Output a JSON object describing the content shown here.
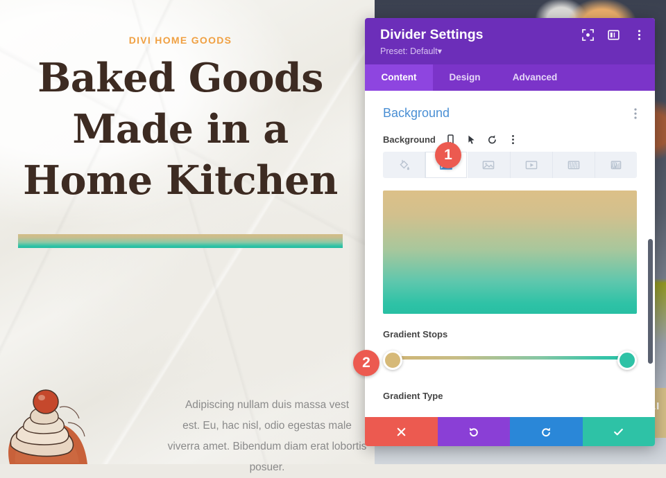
{
  "page": {
    "eyebrow": "DIVI HOME GOODS",
    "headline_lines": [
      "Baked Goods",
      "Made in a",
      "Home Kitchen"
    ],
    "headline": "Baked Goods Made in a Home Kitchen",
    "body_lines": [
      "Adipiscing nullam duis massa vest",
      "est. Eu, hac nisl, odio egestas male",
      "viverra amet. Bibendum diam erat lobortis posuer."
    ],
    "divider_gradient": {
      "from": "#d3bd86",
      "to": "#2ec2a6",
      "direction": "to bottom"
    },
    "accent_color": "#f0a042",
    "heading_color": "#3d2b22",
    "ribbon_text": "LI"
  },
  "modal": {
    "title": "Divider Settings",
    "preset": "Preset: Default",
    "preset_caret": "▾",
    "header_icons": [
      {
        "name": "focus-mode-icon",
        "label": "Focus Mode"
      },
      {
        "name": "panel-layout-icon",
        "label": "Panel Layout"
      },
      {
        "name": "more-options-icon",
        "label": "More Options"
      }
    ],
    "tabs": [
      {
        "label": "Content",
        "active": true
      },
      {
        "label": "Design",
        "active": false
      },
      {
        "label": "Advanced",
        "active": false
      }
    ],
    "header_color": "#6c2eb9",
    "tabbar_color": "#7b34c9",
    "active_tab_color": "#8e45e0"
  },
  "section": {
    "title": "Background",
    "title_color": "#4a8fd4",
    "options_icon": "kebab-menu-icon"
  },
  "background_field": {
    "label": "Background",
    "controls": [
      {
        "name": "responsive-mobile-icon",
        "label": "Responsive"
      },
      {
        "name": "hover-cursor-icon",
        "label": "Hover"
      },
      {
        "name": "reset-icon",
        "label": "Reset"
      },
      {
        "name": "field-options-icon",
        "label": "Options"
      }
    ],
    "type_tabs": [
      {
        "name": "background-color-tab",
        "icon": "paint-bucket-icon",
        "label": "Background Color",
        "active": false
      },
      {
        "name": "background-gradient-tab",
        "icon": "gradient-icon",
        "label": "Background Gradient",
        "active": true
      },
      {
        "name": "background-image-tab",
        "icon": "image-icon",
        "label": "Background Image",
        "active": false
      },
      {
        "name": "background-video-tab",
        "icon": "video-icon",
        "label": "Background Video",
        "active": false
      },
      {
        "name": "background-pattern-tab",
        "icon": "pattern-icon",
        "label": "Background Pattern",
        "active": false
      },
      {
        "name": "background-mask-tab",
        "icon": "mask-icon",
        "label": "Background Mask",
        "active": false
      }
    ]
  },
  "gradient": {
    "preview_from": "#dcc088",
    "preview_to": "#2ec2a6",
    "stops_label": "Gradient Stops",
    "type_label": "Gradient Type",
    "stops": [
      {
        "position": 0,
        "color": "#d6b978"
      },
      {
        "position": 100,
        "color": "#2ec2a6"
      }
    ]
  },
  "footer_buttons": [
    {
      "name": "cancel-button",
      "icon": "close-icon",
      "label": "Cancel",
      "color": "#ec5a50"
    },
    {
      "name": "undo-button",
      "icon": "undo-icon",
      "label": "Undo",
      "color": "#8a3fd6"
    },
    {
      "name": "redo-button",
      "icon": "redo-icon",
      "label": "Redo",
      "color": "#2a87d8"
    },
    {
      "name": "save-button",
      "icon": "check-icon",
      "label": "Save",
      "color": "#2ec2a6"
    }
  ],
  "annotations": [
    {
      "number": "1",
      "color": "#ec5a50"
    },
    {
      "number": "2",
      "color": "#ec5a50"
    }
  ]
}
